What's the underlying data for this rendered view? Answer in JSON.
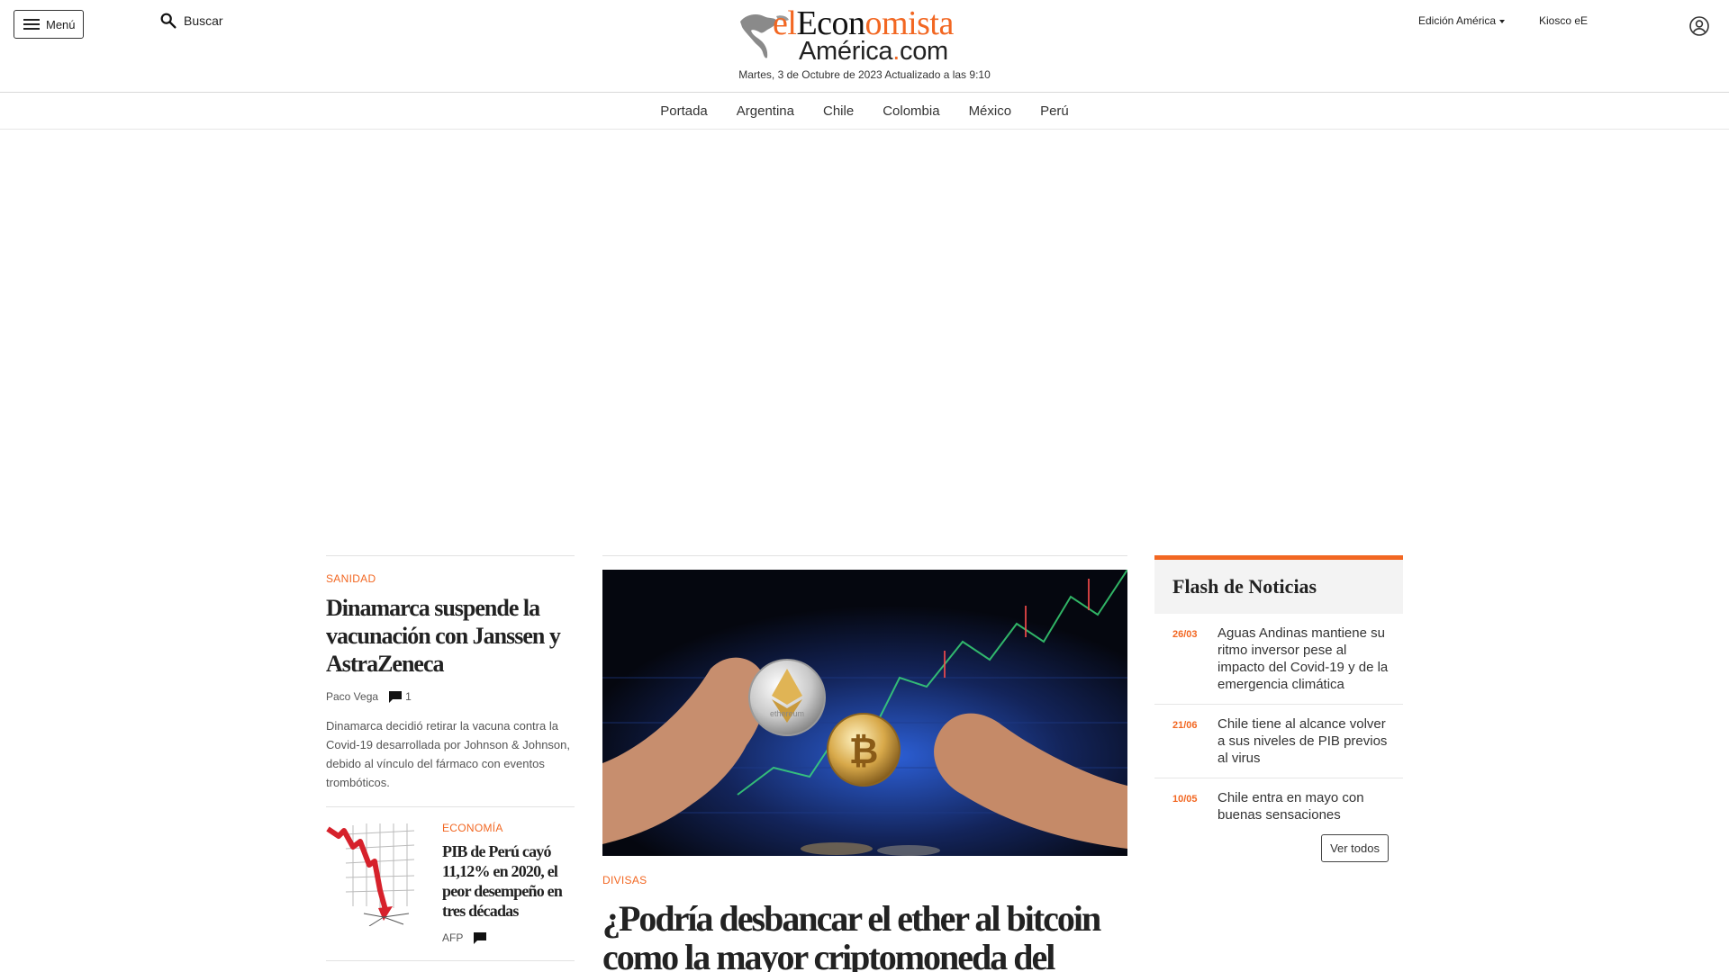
{
  "header": {
    "menu_label": "Menú",
    "search_label": "Buscar",
    "logo": {
      "part_el": "el",
      "part_econ": "Econ",
      "part_omista": "omista",
      "part_america": "América",
      "part_dot": ".",
      "part_com": "com"
    },
    "date_line": "Martes, 3 de Octubre de 2023 Actualizado a las 9:10",
    "edition_label": "Edición América",
    "kiosco_label": "Kiosco eE"
  },
  "nav": {
    "items": [
      "Portada",
      "Argentina",
      "Chile",
      "Colombia",
      "México",
      "Perú"
    ]
  },
  "left": {
    "story1": {
      "kicker": "SANIDAD",
      "headline": "Dinamarca suspende la vacunación con Janssen y AstraZeneca",
      "author": "Paco Vega",
      "comments": "1",
      "summary": "Dinamarca decidió retirar la vacuna contra la Covid-19 desarrollada por Johnson & Johnson, debido al vínculo del fármaco con eventos trombóticos."
    },
    "story2": {
      "kicker": "ECONOMÍA",
      "headline": "PIB de Perú cayó 11,12% en 2020, el peor desempeño en tres décadas",
      "author": "AFP"
    }
  },
  "main": {
    "image_labels": {
      "ether_coin": "ethereum"
    },
    "kicker": "DIVISAS",
    "headline": "¿Podría desbancar el ether al bitcoin como la mayor criptomoneda del"
  },
  "flash": {
    "title": "Flash de Noticias",
    "items": [
      {
        "date": "26/03",
        "text": "Aguas Andinas mantiene su ritmo inversor pese al impacto del Covid-19 y de la emergencia climática"
      },
      {
        "date": "21/06",
        "text": "Chile tiene al alcance volver a sus niveles de PIB previos al virus"
      },
      {
        "date": "10/05",
        "text": "Chile entra en mayo con buenas sensaciones"
      }
    ],
    "ver_todos": "Ver todos"
  },
  "colors": {
    "accent": "#f26722",
    "text": "#222222",
    "muted": "#555555",
    "flash_bg": "#f3f3f3"
  }
}
